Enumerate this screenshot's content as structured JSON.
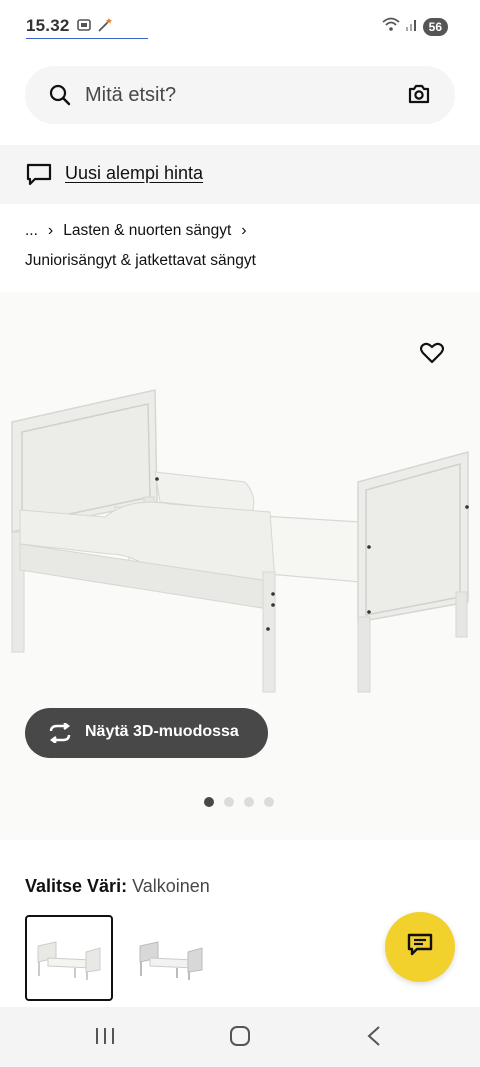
{
  "status_bar": {
    "time": "15.32",
    "battery": "56",
    "icons": [
      "screenshot-icon",
      "magic-wand-icon",
      "wifi-icon",
      "signal-icon"
    ]
  },
  "search": {
    "placeholder": "Mitä etsit?",
    "icons": [
      "search-icon",
      "camera-icon"
    ]
  },
  "promo": {
    "link_text": "Uusi alempi hinta",
    "icon": "chat-bubble-icon"
  },
  "breadcrumb": {
    "items": [
      "...",
      "Lasten & nuorten sängyt"
    ],
    "current": "Juniorisängyt & jatkettavat sängyt"
  },
  "product_image": {
    "wishlist_icon": "heart-icon"
  },
  "view_3d": {
    "label": "Näytä 3D-muodossa",
    "icon": "rotate-icon"
  },
  "carousel": {
    "total": 4,
    "active": 1
  },
  "color": {
    "label": "Valitse Väri:",
    "value": "Valkoinen",
    "swatches": [
      {
        "color": "#f1f1ee",
        "selected": true
      },
      {
        "color": "#d9d9d9",
        "selected": false
      }
    ]
  },
  "chat_fab": {
    "icon": "chat-icon",
    "color": "#f2d12c"
  },
  "nav_bar": {
    "icons": [
      "recent-apps-icon",
      "home-icon",
      "back-icon"
    ]
  }
}
